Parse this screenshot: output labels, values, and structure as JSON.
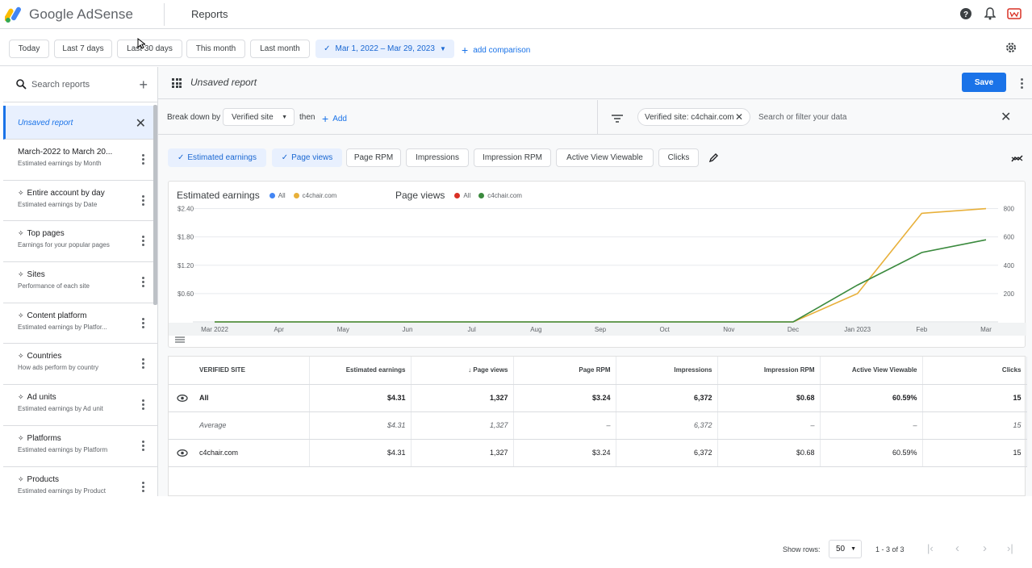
{
  "header": {
    "app_name": "Google AdSense",
    "page_title": "Reports"
  },
  "date_range": {
    "chips": [
      "Today",
      "Last 7 days",
      "Last 30 days",
      "This month",
      "Last month"
    ],
    "selected_range": "Mar 1, 2022 – Mar 29, 2023",
    "add_comparison": "add comparison"
  },
  "sidebar": {
    "search_placeholder": "Search reports",
    "items": [
      {
        "title": "Unsaved report",
        "subtitle": ""
      },
      {
        "title": "March-2022 to March 20...",
        "subtitle": "Estimated earnings by Month"
      },
      {
        "title": "Entire account by day",
        "subtitle": "Estimated earnings by Date"
      },
      {
        "title": "Top pages",
        "subtitle": "Earnings for your popular pages"
      },
      {
        "title": "Sites",
        "subtitle": "Performance of each site"
      },
      {
        "title": "Content platform",
        "subtitle": "Estimated earnings by Platfor..."
      },
      {
        "title": "Countries",
        "subtitle": "How ads perform by country"
      },
      {
        "title": "Ad units",
        "subtitle": "Estimated earnings by Ad unit"
      },
      {
        "title": "Platforms",
        "subtitle": "Estimated earnings by Platform"
      },
      {
        "title": "Products",
        "subtitle": "Estimated earnings by Product"
      }
    ]
  },
  "report": {
    "title": "Unsaved report",
    "save_label": "Save",
    "breakdown_label": "Break down by",
    "breakdown_value": "Verified site",
    "then_label": "then",
    "add_label": "Add",
    "filter_chip": "Verified site: c4chair.com",
    "filter_placeholder": "Search or filter your data"
  },
  "metrics": [
    {
      "label": "Estimated earnings",
      "selected": true
    },
    {
      "label": "Page views",
      "selected": true
    },
    {
      "label": "Page RPM",
      "selected": false
    },
    {
      "label": "Impressions",
      "selected": false
    },
    {
      "label": "Impression RPM",
      "selected": false
    },
    {
      "label": "Active View Viewable",
      "selected": false
    },
    {
      "label": "Clicks",
      "selected": false
    }
  ],
  "chart_legend": {
    "left_title": "Estimated earnings",
    "left_all": "All",
    "left_site": "c4chair.com",
    "right_title": "Page views",
    "right_all": "All",
    "right_site": "c4chair.com"
  },
  "colors": {
    "blue": "#1a73e8",
    "earnings_all": "#4285f4",
    "earnings_site": "#e8b03a",
    "pageviews_all": "#d93025",
    "pageviews_site": "#3b8a3e"
  },
  "chart_data": {
    "type": "line",
    "x": [
      "Mar 2022",
      "Apr",
      "May",
      "Jun",
      "Jul",
      "Aug",
      "Sep",
      "Oct",
      "Nov",
      "Dec",
      "Jan 2023",
      "Feb",
      "Mar"
    ],
    "y_left_ticks": [
      "$0.60",
      "$1.20",
      "$1.80",
      "$2.40"
    ],
    "y_right_ticks": [
      "200",
      "400",
      "600",
      "800"
    ],
    "ylim_left": [
      0,
      2.7
    ],
    "ylim_right": [
      0,
      900
    ],
    "series": [
      {
        "name": "c4chair.com",
        "axis": "left",
        "values": [
          0,
          0,
          0,
          0,
          0,
          0,
          0,
          0,
          0,
          0,
          0.6,
          2.3,
          2.4
        ]
      },
      {
        "name": "c4chair.com",
        "axis": "right",
        "values": [
          0,
          0,
          0,
          0,
          0,
          0,
          0,
          0,
          0,
          0,
          260,
          490,
          580
        ]
      }
    ],
    "grid": true
  },
  "table": {
    "columns": [
      "VERIFIED SITE",
      "Estimated earnings",
      "Page views",
      "Page RPM",
      "Impressions",
      "Impression RPM",
      "Active View Viewable",
      "Clicks"
    ],
    "rows": [
      [
        "All",
        "$4.31",
        "1,327",
        "$3.24",
        "6,372",
        "$0.68",
        "60.59%",
        "15"
      ],
      [
        "Average",
        "$4.31",
        "1,327",
        "–",
        "6,372",
        "–",
        "–",
        "15"
      ],
      [
        "c4chair.com",
        "$4.31",
        "1,327",
        "$3.24",
        "6,372",
        "$0.68",
        "60.59%",
        "15"
      ]
    ],
    "show_rows_label": "Show rows:",
    "rows_value": "50",
    "range_text": "1 - 3 of 3"
  }
}
